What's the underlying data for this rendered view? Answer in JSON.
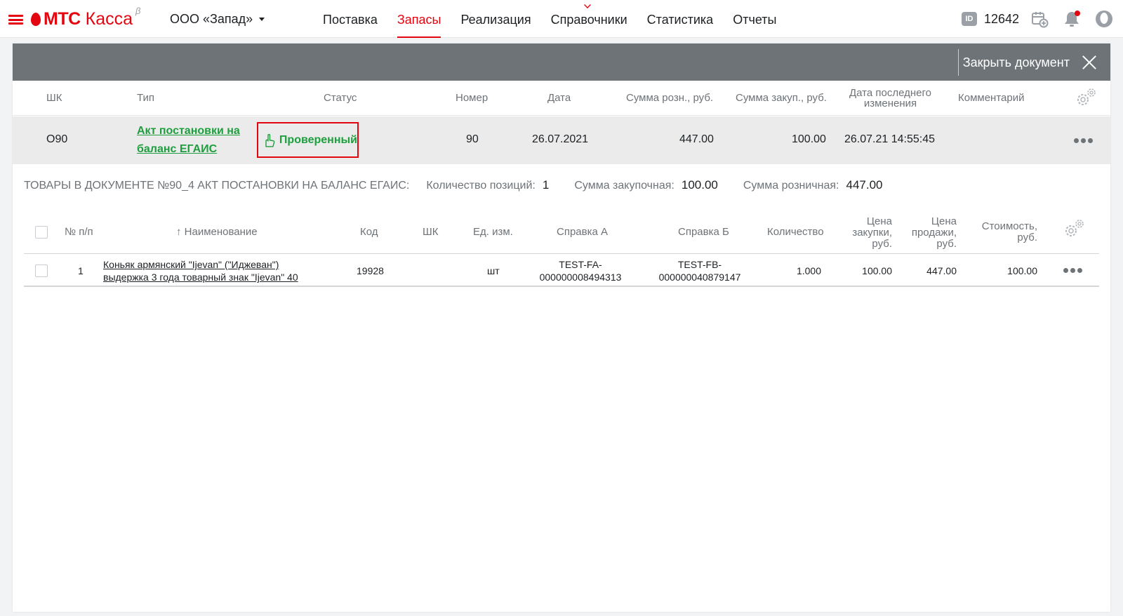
{
  "header": {
    "logo_brand": "МТС",
    "logo_product": "Касса",
    "logo_beta": "β",
    "org_name": "ООО «Запад»",
    "nav": [
      {
        "label": "Поставка"
      },
      {
        "label": "Запасы"
      },
      {
        "label": "Реализация"
      },
      {
        "label": "Справочники"
      },
      {
        "label": "Статистика"
      },
      {
        "label": "Отчеты"
      }
    ],
    "active_nav": "Запасы",
    "id_badge": "ID",
    "user_id": "12642",
    "icons": [
      "menu-icon",
      "id-icon",
      "calendar-add-icon",
      "bell-icon",
      "user-avatar-icon"
    ],
    "accent_color": "#e30611"
  },
  "panel": {
    "close_label": "Закрыть документ"
  },
  "doc_table": {
    "columns": [
      "ШК",
      "Тип",
      "Статус",
      "Номер",
      "Дата",
      "Сумма розн., руб.",
      "Сумма закуп., руб.",
      "Дата последнего изменения",
      "Комментарий"
    ],
    "last_change_header_line1": "Дата последнего",
    "last_change_header_line2": "изменения",
    "row": {
      "barcode": "О90",
      "type": "Акт постановки на баланс ЕГАИС",
      "status": "Проверенный",
      "number": "90",
      "date": "26.07.2021",
      "sum_retail": "447.00",
      "sum_purchase": "100.00",
      "last_change": "26.07.21 14:55:45",
      "comment": ""
    },
    "status_color": "#1e9e3e"
  },
  "summary": {
    "title": "ТОВАРЫ В ДОКУМЕНТЕ №90_4 АКТ ПОСТАНОВКИ НА БАЛАНС ЕГАИС:",
    "positions_label": "Количество позиций:",
    "positions_value": "1",
    "purchase_label": "Сумма закупочная:",
    "purchase_value": "100.00",
    "retail_label": "Сумма розничная:",
    "retail_value": "447.00"
  },
  "items_table": {
    "columns": {
      "num": "№ п/п",
      "name": "Наименование",
      "code": "Код",
      "barcode": "ШК",
      "unit": "Ед. изм.",
      "ref_a": "Справка А",
      "ref_b": "Справка Б",
      "qty": "Количество",
      "price_purchase_1": "Цена",
      "price_purchase_2": "закупки,",
      "price_purchase_3": "руб.",
      "price_sale_1": "Цена",
      "price_sale_2": "продажи,",
      "price_sale_3": "руб.",
      "cost_1": "Стоимость,",
      "cost_2": "руб."
    },
    "sort_arrow": "↑",
    "rows": [
      {
        "num": "1",
        "name_line1": "Коньяк армянский \"Ijevan\" (\"Иджеван\")",
        "name_line2": "выдержка 3 года товарный знак \"Ijevan\" 40",
        "code": "19928",
        "barcode": "",
        "unit": "шт",
        "ref_a_line1": "TEST-FA-",
        "ref_a_line2": "000000008494313",
        "ref_b_line1": "TEST-FB-",
        "ref_b_line2": "000000040879147",
        "qty": "1.000",
        "price_purchase": "100.00",
        "price_sale": "447.00",
        "cost": "100.00"
      }
    ]
  }
}
